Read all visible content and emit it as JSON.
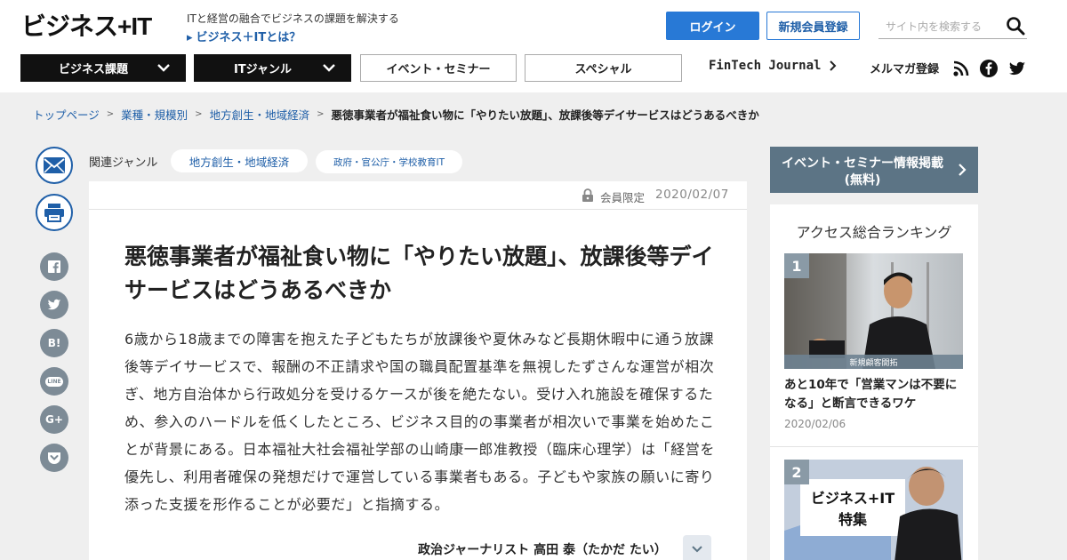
{
  "header": {
    "logo_text": "ビジネス+IT",
    "tagline": "ITと経営の融合でビジネスの課題を解決する",
    "about_link": "ビジネス＋ITとは？",
    "login_label": "ログイン",
    "register_label": "新規会員登録",
    "search_placeholder": "サイト内を検索する"
  },
  "nav": {
    "business_topics": "ビジネス課題",
    "it_genre": "ITジャンル",
    "events": "イベント・セミナー",
    "special": "スペシャル",
    "fintech": "FinTech Journal",
    "mailmag": "メルマガ登録",
    "social_icons": [
      "rss-icon",
      "facebook-icon",
      "twitter-icon"
    ]
  },
  "breadcrumb": {
    "items": [
      "トップページ",
      "業種・規模別",
      "地方創生・地域経済"
    ],
    "separator": ">",
    "current": "悪徳事業者が福祉食い物に「やりたい放題」、放課後等デイサービスはどうあるべきか"
  },
  "share": {
    "icons": [
      "mail-icon",
      "print-icon",
      "facebook-icon",
      "twitter-icon",
      "hatena-icon",
      "line-icon",
      "google-plus-icon",
      "pocket-icon"
    ],
    "hatena_text": "B!",
    "line_text": "LINE",
    "gplus_text": "G+"
  },
  "genre": {
    "label": "関連ジャンル",
    "tags": [
      "地方創生・地域経済",
      "政府・官公庁・学校教育IT"
    ]
  },
  "article": {
    "members_only": "会員限定",
    "date": "2020/02/07",
    "title": "悪徳事業者が福祉食い物に「やりたい放題」、放課後等デイサービスはどうあるべきか",
    "lead": "6歳から18歳までの障害を抱えた子どもたちが放課後や夏休みなど長期休暇中に通う放課後等デイサービスで、報酬の不正請求や国の職員配置基準を無視したずさんな運営が相次ぎ、地方自治体から行政処分を受けるケースが後を絶たない。受け入れ施設を確保するため、参入のハードルを低くしたところ、ビジネス目的の事業者が相次いで事業を始めたことが背景にある。日本福祉大社会福祉学部の山崎康一郎准教授（臨床心理学）は「経営を優先し、利用者確保の発想だけで運営している事業者もある。子どもや家族の願いに寄り添った支援を形作ることが必要だ」と指摘する。",
    "author": "政治ジャーナリスト 高田 泰（たかだ たい）"
  },
  "sidebar": {
    "event_banner_line1": "イベント・セミナー情報掲載",
    "event_banner_line2": "(無料)",
    "ranking_title": "アクセス総合ランキング",
    "items": [
      {
        "rank": "1",
        "image_caption": "新規顧客開拓",
        "title": "あと10年で「営業マンは不要になる」と断言できるワケ",
        "date": "2020/02/06"
      },
      {
        "rank": "2",
        "image_title_line1": "ビジネス+IT",
        "image_title_line2": "特集"
      }
    ]
  },
  "colors": {
    "brand_blue": "#2879d6",
    "link_blue": "#1f5fa8",
    "nav_dark": "#111111",
    "banner_slate": "#5c7485",
    "page_bg": "#efefef"
  }
}
